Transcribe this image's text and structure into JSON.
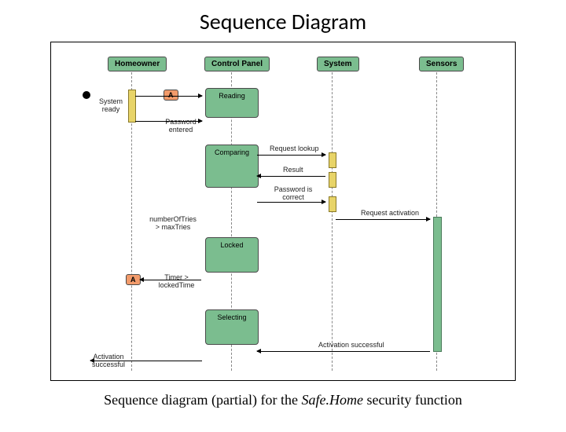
{
  "title": "Sequence Diagram",
  "caption_prefix": "Sequence diagram (partial) for the ",
  "caption_italic": "Safe.Home",
  "caption_suffix": " security function",
  "lifelines": {
    "homeowner": "Homeowner",
    "control_panel": "Control Panel",
    "system": "System",
    "sensors": "Sensors"
  },
  "states": {
    "reading": "Reading",
    "comparing": "Comparing",
    "locked": "Locked",
    "selecting": "Selecting"
  },
  "markers": {
    "a1": "A",
    "a2": "A"
  },
  "messages": {
    "system_ready": "System\nready",
    "password_entered": "Password\nentered",
    "request_lookup": "Request lookup",
    "result": "Result",
    "password_correct": "Password is\ncorrect",
    "number_tries": "numberOfTries\n> maxTries",
    "timer_locked": "Timer >\nlockedTime",
    "request_activation": "Request activation",
    "activation_successful_1": "Activation successful",
    "activation_successful_2": "Activation\nsuccessful"
  }
}
